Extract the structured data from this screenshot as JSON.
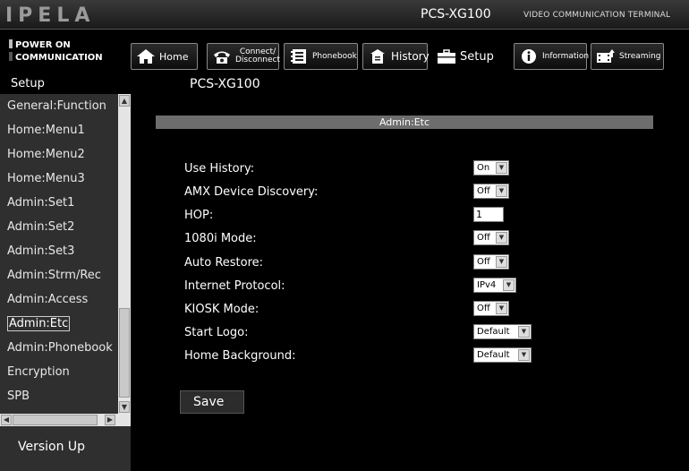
{
  "header": {
    "logo": "IPELA",
    "model": "PCS-XG100",
    "terminal": "VIDEO COMMUNICATION TERMINAL"
  },
  "status": {
    "power": "POWER ON",
    "communication": "COMMUNICATION"
  },
  "nav": {
    "home": "Home",
    "connect_line1": "Connect/",
    "connect_line2": "Disconnect",
    "phonebook": "Phonebook",
    "history": "History",
    "setup": "Setup",
    "information": "Information",
    "streaming": "Streaming"
  },
  "breadcrumb": {
    "section": "Setup",
    "model": "PCS-XG100"
  },
  "sidebar": {
    "items": [
      {
        "label": "General:Function"
      },
      {
        "label": "Home:Menu1"
      },
      {
        "label": "Home:Menu2"
      },
      {
        "label": "Home:Menu3"
      },
      {
        "label": "Admin:Set1"
      },
      {
        "label": "Admin:Set2"
      },
      {
        "label": "Admin:Set3"
      },
      {
        "label": "Admin:Strm/Rec"
      },
      {
        "label": "Admin:Access"
      },
      {
        "label": "Admin:Etc"
      },
      {
        "label": "Admin:Phonebook"
      },
      {
        "label": "Encryption"
      },
      {
        "label": "SPB"
      }
    ],
    "active_index": 9,
    "version": "Version Up"
  },
  "main": {
    "section_title": "Admin:Etc",
    "settings": [
      {
        "label": "Use History:",
        "value": "On"
      },
      {
        "label": "AMX Device Discovery:",
        "value": "Off"
      },
      {
        "label": "HOP:",
        "value": "1"
      },
      {
        "label": "1080i Mode:",
        "value": "Off"
      },
      {
        "label": "Auto Restore:",
        "value": "Off"
      },
      {
        "label": "Internet Protocol:",
        "value": "IPv4"
      },
      {
        "label": "KIOSK Mode:",
        "value": "Off"
      },
      {
        "label": "Start Logo:",
        "value": "Default"
      },
      {
        "label": "Home Background:",
        "value": "Default"
      }
    ],
    "save_label": "Save"
  }
}
